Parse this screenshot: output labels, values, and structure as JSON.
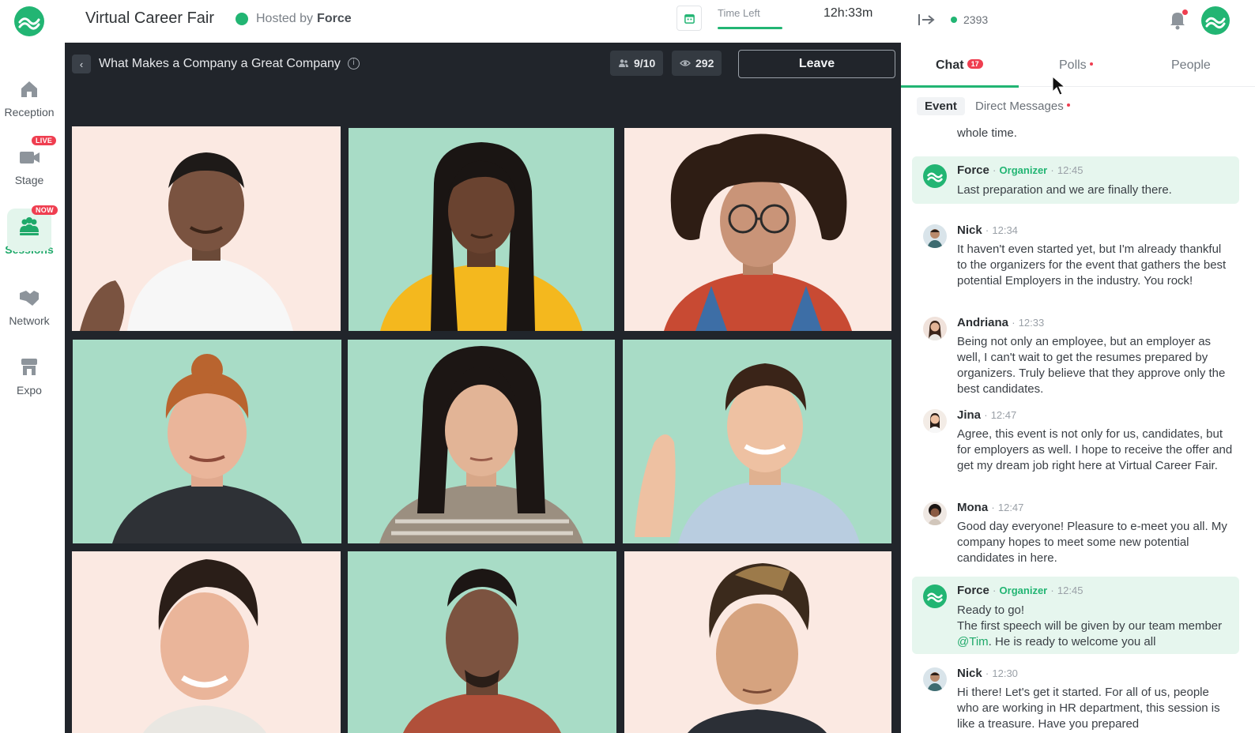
{
  "app": {
    "title": "Virtual Career Fair",
    "hosted_by_prefix": "Hosted by",
    "host_name": "Force",
    "time_left_label": "Time Left",
    "time_left_value": "12h:33m"
  },
  "nav": [
    {
      "label": "Reception",
      "icon": "home-icon",
      "badge": ""
    },
    {
      "label": "Stage",
      "icon": "camera-icon",
      "badge": "LIVE"
    },
    {
      "label": "Sessions",
      "icon": "group-icon",
      "badge": "NOW"
    },
    {
      "label": "Network",
      "icon": "handshake-icon",
      "badge": ""
    },
    {
      "label": "Expo",
      "icon": "booth-icon",
      "badge": ""
    }
  ],
  "session": {
    "title": "What Makes a Company a Great Company",
    "participants": "9/10",
    "viewers": "292",
    "leave_label": "Leave"
  },
  "panel": {
    "online_count": "2393",
    "tabs": [
      {
        "label": "Chat",
        "count": "17"
      },
      {
        "label": "Polls"
      },
      {
        "label": "People"
      }
    ],
    "subtabs": [
      "Event",
      "Direct Messages"
    ],
    "partial_message": "whole time.",
    "messages": [
      {
        "name": "Force",
        "role": "Organizer",
        "time": "12:45",
        "text": "Last preparation and we are finally there."
      },
      {
        "name": "Nick",
        "time": "12:34",
        "text": "It haven't even started yet, but I'm already thankful to the organizers for the event that gathers the best potential Employers in the industry. You rock!"
      },
      {
        "name": "Andriana",
        "time": "12:33",
        "text": "Being not only an employee, but an employer as well, I can't wait to get the resumes prepared by organizers. Truly believe that they approve only the best candidates."
      },
      {
        "name": "Jina",
        "time": "12:47",
        "text": "Agree, this event is not only for us, candidates, but for employers as well. I hope to receive the offer and get my dream job right here at Virtual Career Fair."
      },
      {
        "name": "Mona",
        "time": "12:47",
        "text": "Good day everyone! Pleasure to e-meet you all. My company hopes to meet some new potential candidates in here."
      },
      {
        "name": "Force",
        "role": "Organizer",
        "time": "12:45",
        "text_line1": "Ready to go!",
        "text_line2": "The first speech will be given by our team member",
        "mention": "@Tim",
        "text_tail": ". He is ready to welcome you all"
      },
      {
        "name": "Nick",
        "time": "12:30",
        "text": "Hi there! Let's get it started. For all of us, people who are working in HR department, this session is like a treasure. Have you prepared"
      }
    ]
  },
  "colors": {
    "brand": "#22b573",
    "stage_bg": "#21252b",
    "badge_red": "#ef3e50",
    "tile_mint": "#a8dcc6",
    "tile_peach": "#fbe9e2"
  }
}
